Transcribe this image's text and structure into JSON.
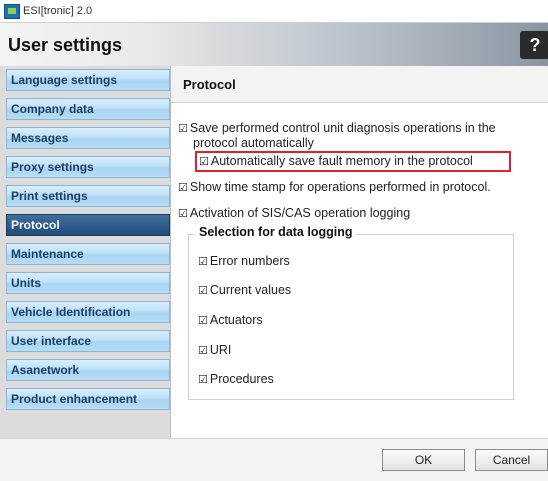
{
  "window": {
    "title": "ESI[tronic] 2.0"
  },
  "header": {
    "title": "User settings",
    "help_label": "?"
  },
  "sidebar": {
    "items": [
      {
        "label": "Language settings"
      },
      {
        "label": "Company data"
      },
      {
        "label": "Messages"
      },
      {
        "label": "Proxy settings"
      },
      {
        "label": "Print settings"
      },
      {
        "label": "Protocol",
        "active": true
      },
      {
        "label": "Maintenance"
      },
      {
        "label": "Units"
      },
      {
        "label": "Vehicle Identification"
      },
      {
        "label": "User interface"
      },
      {
        "label": "Asanetwork"
      },
      {
        "label": "Product enhancement"
      }
    ]
  },
  "content": {
    "title": "Protocol",
    "options": {
      "save_operations_line1": "Save performed control unit diagnosis operations in the",
      "save_operations_line2": "protocol automatically",
      "save_fault_memory": "Automatically save fault memory in the protocol",
      "show_timestamp": "Show time stamp for operations performed in protocol.",
      "sis_cas_logging": "Activation of SIS/CAS operation logging"
    },
    "data_logging": {
      "legend": "Selection for data logging",
      "items": [
        {
          "label": "Error numbers"
        },
        {
          "label": "Current values"
        },
        {
          "label": "Actuators"
        },
        {
          "label": "URI"
        },
        {
          "label": "Procedures"
        }
      ]
    },
    "checkbox_glyph": "☑"
  },
  "footer": {
    "ok_label": "OK",
    "cancel_label": "Cancel"
  },
  "colors": {
    "highlight": "#e0202a",
    "active_nav": "#1f4c7a",
    "nav_bg": "#bfe1f8"
  }
}
